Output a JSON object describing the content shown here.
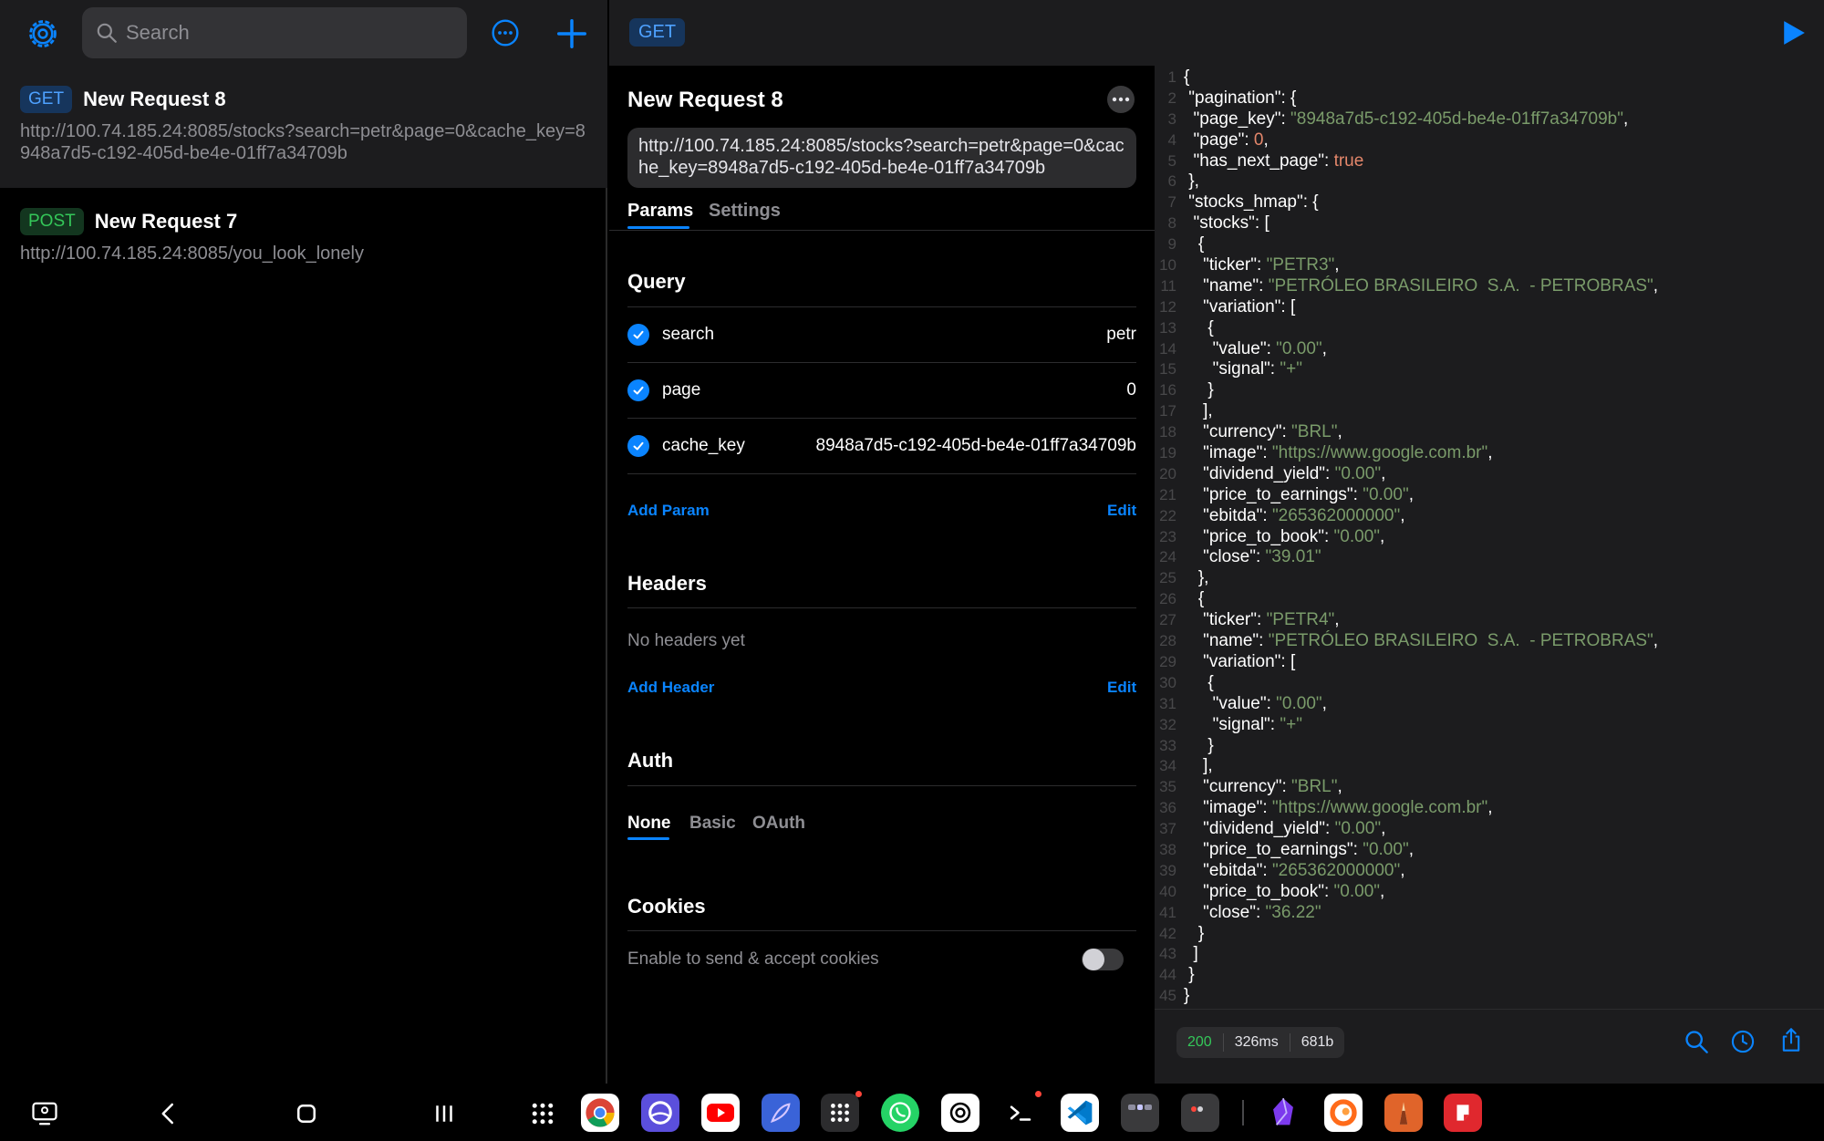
{
  "sidebar": {
    "search_placeholder": "Search",
    "requests": [
      {
        "method": "GET",
        "name": "New Request 8",
        "url": "http://100.74.185.24:8085/stocks?search=petr&page=0&cache_key=8948a7d5-c192-405d-be4e-01ff7a34709b"
      },
      {
        "method": "POST",
        "name": "New Request 7",
        "url": "http://100.74.185.24:8085/you_look_lonely"
      }
    ]
  },
  "request": {
    "method": "GET",
    "title": "New Request 8",
    "url": "http://100.74.185.24:8085/stocks?search=petr&page=0&cache_key=8948a7d5-c192-405d-be4e-01ff7a34709b",
    "tabs": [
      "Params",
      "Settings"
    ],
    "query_title": "Query",
    "params": [
      {
        "key": "search",
        "value": "petr"
      },
      {
        "key": "page",
        "value": "0"
      },
      {
        "key": "cache_key",
        "value": "8948a7d5-c192-405d-be4e-01ff7a34709b"
      }
    ],
    "add_param": "Add Param",
    "edit": "Edit",
    "headers_title": "Headers",
    "no_headers": "No headers yet",
    "add_header": "Add Header",
    "auth_title": "Auth",
    "auth_tabs": [
      "None",
      "Basic",
      "OAuth"
    ],
    "cookies_title": "Cookies",
    "cookies_label": "Enable to send & accept cookies",
    "cookies_enabled": false
  },
  "response": {
    "status": "200",
    "time": "326ms",
    "size": "681b",
    "lines": [
      [
        [
          "p",
          "{"
        ]
      ],
      [
        [
          "k",
          " \"pagination\": {"
        ]
      ],
      [
        [
          "k",
          "  \"page_key\": "
        ],
        [
          "s",
          "\"8948a7d5-c192-405d-be4e-01ff7a34709b\""
        ],
        [
          "k",
          ","
        ]
      ],
      [
        [
          "k",
          "  \"page\": "
        ],
        [
          "n",
          "0"
        ],
        [
          "k",
          ","
        ]
      ],
      [
        [
          "k",
          "  \"has_next_page\": "
        ],
        [
          "b",
          "true"
        ]
      ],
      [
        [
          "k",
          " },"
        ]
      ],
      [
        [
          "k",
          " \"stocks_hmap\": {"
        ]
      ],
      [
        [
          "k",
          "  \"stocks\": ["
        ]
      ],
      [
        [
          "k",
          "   {"
        ]
      ],
      [
        [
          "k",
          "    \"ticker\": "
        ],
        [
          "s",
          "\"PETR3\""
        ],
        [
          "k",
          ","
        ]
      ],
      [
        [
          "k",
          "    \"name\": "
        ],
        [
          "s",
          "\"PETRÓLEO BRASILEIRO  S.A.  - PETROBRAS\""
        ],
        [
          "k",
          ","
        ]
      ],
      [
        [
          "k",
          "    \"variation\": ["
        ]
      ],
      [
        [
          "k",
          "     {"
        ]
      ],
      [
        [
          "k",
          "      \"value\": "
        ],
        [
          "s",
          "\"0.00\""
        ],
        [
          "k",
          ","
        ]
      ],
      [
        [
          "k",
          "      \"signal\": "
        ],
        [
          "s",
          "\"+\""
        ]
      ],
      [
        [
          "k",
          "     }"
        ]
      ],
      [
        [
          "k",
          "    ],"
        ]
      ],
      [
        [
          "k",
          "    \"currency\": "
        ],
        [
          "s",
          "\"BRL\""
        ],
        [
          "k",
          ","
        ]
      ],
      [
        [
          "k",
          "    \"image\": "
        ],
        [
          "s",
          "\"https://www.google.com.br\""
        ],
        [
          "k",
          ","
        ]
      ],
      [
        [
          "k",
          "    \"dividend_yield\": "
        ],
        [
          "s",
          "\"0.00\""
        ],
        [
          "k",
          ","
        ]
      ],
      [
        [
          "k",
          "    \"price_to_earnings\": "
        ],
        [
          "s",
          "\"0.00\""
        ],
        [
          "k",
          ","
        ]
      ],
      [
        [
          "k",
          "    \"ebitda\": "
        ],
        [
          "s",
          "\"265362000000\""
        ],
        [
          "k",
          ","
        ]
      ],
      [
        [
          "k",
          "    \"price_to_book\": "
        ],
        [
          "s",
          "\"0.00\""
        ],
        [
          "k",
          ","
        ]
      ],
      [
        [
          "k",
          "    \"close\": "
        ],
        [
          "s",
          "\"39.01\""
        ]
      ],
      [
        [
          "k",
          "   },"
        ]
      ],
      [
        [
          "k",
          "   {"
        ]
      ],
      [
        [
          "k",
          "    \"ticker\": "
        ],
        [
          "s",
          "\"PETR4\""
        ],
        [
          "k",
          ","
        ]
      ],
      [
        [
          "k",
          "    \"name\": "
        ],
        [
          "s",
          "\"PETRÓLEO BRASILEIRO  S.A.  - PETROBRAS\""
        ],
        [
          "k",
          ","
        ]
      ],
      [
        [
          "k",
          "    \"variation\": ["
        ]
      ],
      [
        [
          "k",
          "     {"
        ]
      ],
      [
        [
          "k",
          "      \"value\": "
        ],
        [
          "s",
          "\"0.00\""
        ],
        [
          "k",
          ","
        ]
      ],
      [
        [
          "k",
          "      \"signal\": "
        ],
        [
          "s",
          "\"+\""
        ]
      ],
      [
        [
          "k",
          "     }"
        ]
      ],
      [
        [
          "k",
          "    ],"
        ]
      ],
      [
        [
          "k",
          "    \"currency\": "
        ],
        [
          "s",
          "\"BRL\""
        ],
        [
          "k",
          ","
        ]
      ],
      [
        [
          "k",
          "    \"image\": "
        ],
        [
          "s",
          "\"https://www.google.com.br\""
        ],
        [
          "k",
          ","
        ]
      ],
      [
        [
          "k",
          "    \"dividend_yield\": "
        ],
        [
          "s",
          "\"0.00\""
        ],
        [
          "k",
          ","
        ]
      ],
      [
        [
          "k",
          "    \"price_to_earnings\": "
        ],
        [
          "s",
          "\"0.00\""
        ],
        [
          "k",
          ","
        ]
      ],
      [
        [
          "k",
          "    \"ebitda\": "
        ],
        [
          "s",
          "\"265362000000\""
        ],
        [
          "k",
          ","
        ]
      ],
      [
        [
          "k",
          "    \"price_to_book\": "
        ],
        [
          "s",
          "\"0.00\""
        ],
        [
          "k",
          ","
        ]
      ],
      [
        [
          "k",
          "    \"close\": "
        ],
        [
          "s",
          "\"36.22\""
        ]
      ],
      [
        [
          "k",
          "   }"
        ]
      ],
      [
        [
          "k",
          "  ]"
        ]
      ],
      [
        [
          "k",
          " }"
        ]
      ],
      [
        [
          "p",
          "}"
        ]
      ]
    ]
  },
  "colors": {
    "accent": "#0a84ff",
    "get_badge": "#4ea1ff",
    "post_badge": "#34c759",
    "json_string": "#7a9b6a",
    "json_number": "#e4876b",
    "status_ok": "#34c759"
  },
  "taskbar": {
    "icons": [
      "screen-share-icon",
      "back-icon",
      "home-icon",
      "recents-icon",
      "app-drawer-icon",
      "chrome-icon",
      "browser-icon",
      "youtube-icon",
      "feather-app-icon",
      "launcher-icon",
      "whatsapp-icon",
      "chatgpt-icon",
      "terminal-icon",
      "vscode-icon",
      "folder-icon",
      "app-icon",
      "obsidian-icon",
      "coppertop-icon",
      "pencil-app-icon",
      "remnote-icon"
    ]
  }
}
